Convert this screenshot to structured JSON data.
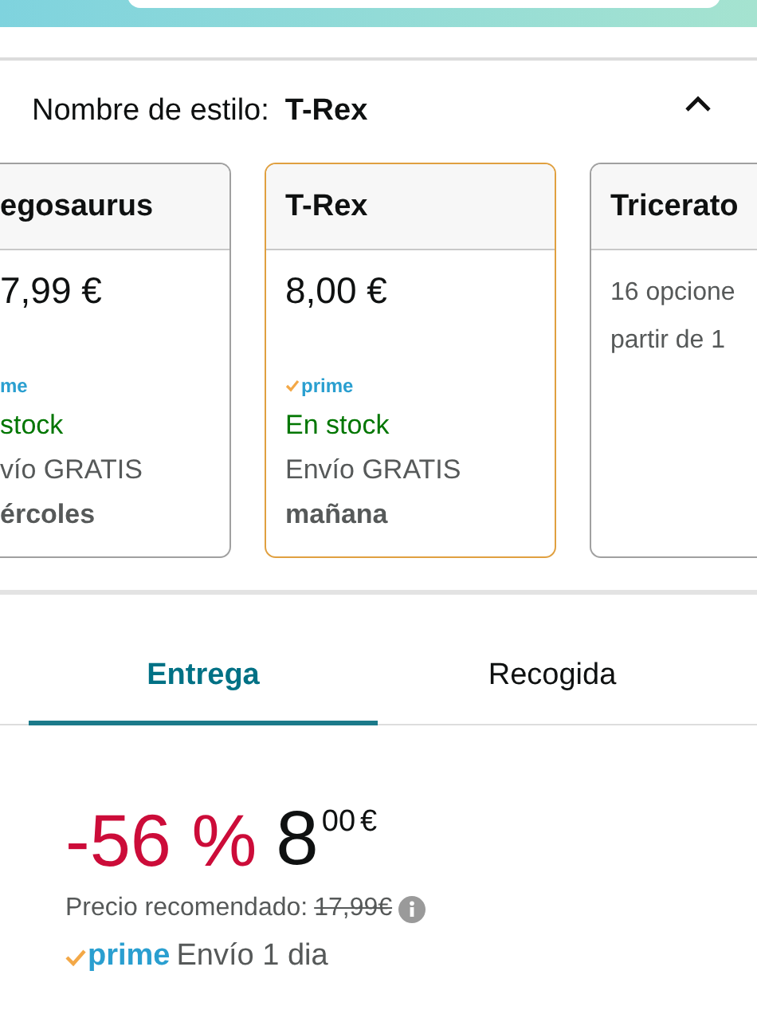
{
  "style_section": {
    "label": "Nombre de estilo:",
    "value": "T-Rex",
    "expanded": true
  },
  "cards": [
    {
      "kind": "cut_left",
      "name": "egosaurus",
      "price": "7,99 €",
      "prime": {
        "check": false,
        "label": "me"
      },
      "stock": "stock",
      "shipping": "vío GRATIS",
      "date": "ércoles",
      "selected": false
    },
    {
      "kind": "full",
      "name": "T-Rex",
      "price": "8,00 €",
      "prime": {
        "check": true,
        "label": "prime"
      },
      "stock": "En stock",
      "shipping": "Envío GRATIS",
      "date": "mañana",
      "selected": true
    },
    {
      "kind": "cut_right",
      "name": "Triceratо",
      "lines": [
        "16 opcione",
        "partir de 1"
      ],
      "selected": false
    }
  ],
  "tabs": [
    {
      "label": "Entrega",
      "selected": true
    },
    {
      "label": "Recogida",
      "selected": false
    }
  ],
  "price": {
    "discount": "-56 %",
    "whole": "8",
    "fraction": "00",
    "currency": "€"
  },
  "list_price": {
    "label": "Precio recomendado:",
    "value": "17,99€"
  },
  "delivery": {
    "prime": "prime",
    "text": "Envío 1 dia"
  }
}
